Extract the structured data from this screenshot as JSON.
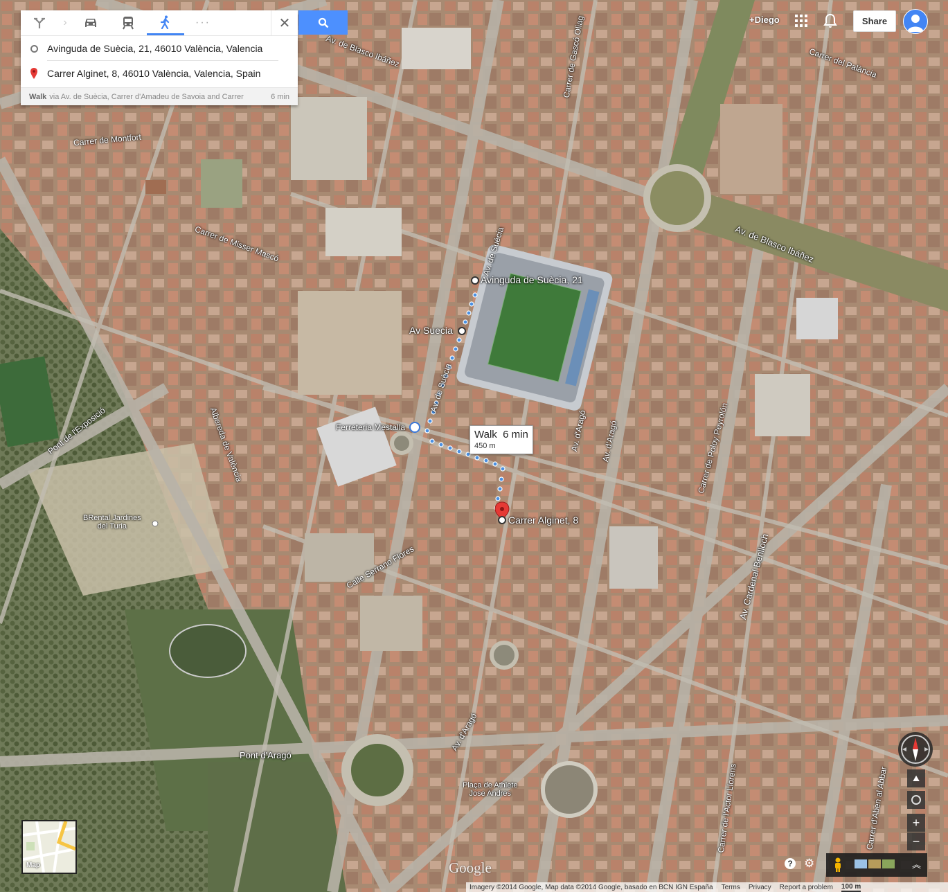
{
  "directions": {
    "modes": [
      "route-options",
      "driving",
      "transit",
      "walking",
      "more"
    ],
    "more_label": "···",
    "close_label": "✕",
    "origin": "Avinguda de Suècia, 21, 46010 València, Valencia",
    "destination": "Carrer Alginet, 8, 46010 València, Valencia, Spain",
    "route_mode": "Walk",
    "route_via": "via Av. de Suècia, Carrer d'Amadeu de Savoia and Carrer",
    "route_time": "6 min"
  },
  "header": {
    "user": "+Diego",
    "share_label": "Share"
  },
  "walk_callout": {
    "title": "Walk  6 min",
    "distance": "450 m"
  },
  "map_labels": {
    "blasco1": "Av. de Blasco Ibáñez",
    "blasco2": "Av. de Blasco Ibáñez",
    "montfort": "Carrer de Montfort",
    "misser": "Carrer de Misser Mascó",
    "suecia1": "Av. de Suècia",
    "suecia2": "Av. de Suècia",
    "arago1": "Av. d'Aragó",
    "arago2": "Av. d'Aragó",
    "arago3": "Av. d'Aragó",
    "gasco": "Carrer de Gascó Oliag",
    "palancia": "Carrer del Palància",
    "poloy": "Carrer de Poloy Peyrolón",
    "benlloch": "Av. Cardenal Benlloch",
    "serrano": "Calle Serrano Flores",
    "alameda": "Albereda de València",
    "exposicio": "Pont de l'Exposició",
    "pontarago": "Pont d'Aragó",
    "jardines": "BRental Jardines\ndel Turia",
    "placa": "Plaça de Athlete\nJose Andres",
    "llorens": "Carrer de l'Actor Llorens",
    "aben": "Carrer d'Aben al Abbar",
    "ferreteria": "Ferreteria Mestalla",
    "pin_origin": "Avinguda de Suècia, 21",
    "pin_stop": "Av Suecia",
    "pin_dest": "Carrer Alginet, 8"
  },
  "controls": {
    "zoom_in": "+",
    "zoom_out": "−",
    "minimap_label": "Map",
    "google": "Google",
    "help": "?"
  },
  "footer": {
    "imagery": "Imagery ©2014 Google, Map data ©2014 Google, basado en BCN IGN España",
    "terms": "Terms",
    "privacy": "Privacy",
    "report": "Report a problem",
    "scale": "100 m"
  }
}
